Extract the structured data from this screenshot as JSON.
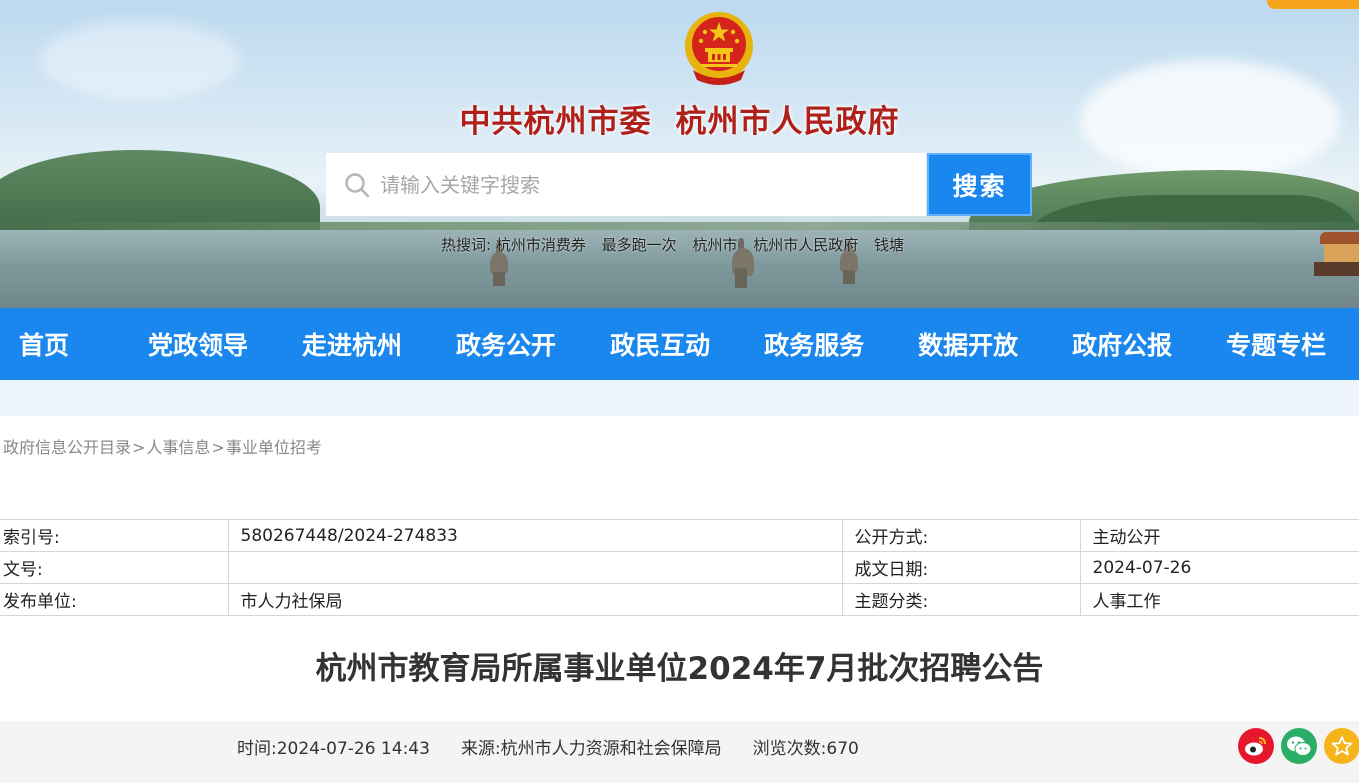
{
  "header": {
    "title_party": "中共杭州市委",
    "title_gov": "杭州市人民政府",
    "emblem_icon": "national-emblem-icon"
  },
  "search": {
    "placeholder": "请输入关键字搜索",
    "button_label": "搜索",
    "hot_label": "热搜词:",
    "hot_words": [
      "杭州市消费券",
      "最多跑一次",
      "杭州市",
      "杭州市人民政府",
      "钱塘"
    ]
  },
  "nav": {
    "items": [
      "首页",
      "党政领导",
      "走进杭州",
      "政务公开",
      "政民互动",
      "政务服务",
      "数据开放",
      "政府公报",
      "专题专栏"
    ]
  },
  "breadcrumb": {
    "items": [
      "政府信息公开目录",
      "人事信息",
      "事业单位招考"
    ],
    "separator": ">"
  },
  "meta": {
    "index_label": "索引号:",
    "index_value": "580267448/2024-274833",
    "method_label": "公开方式:",
    "method_value": "主动公开",
    "docno_label": "文号:",
    "docno_value": "",
    "date_label": "成文日期:",
    "date_value": "2024-07-26",
    "publisher_label": "发布单位:",
    "publisher_value": "市人力社保局",
    "topic_label": "主题分类:",
    "topic_value": "人事工作"
  },
  "article": {
    "title": "杭州市教育局所属事业单位2024年7月批次招聘公告",
    "time_label": "时间:",
    "time_value": "2024-07-26 14:43",
    "source_label": "来源:",
    "source_value": "杭州市人力资源和社会保障局",
    "views_label": "浏览次数:",
    "views_value": "670"
  },
  "colors": {
    "nav_bg": "#1a87ee",
    "title_red": "#b0201a",
    "accent_orange": "#f7a51c"
  }
}
